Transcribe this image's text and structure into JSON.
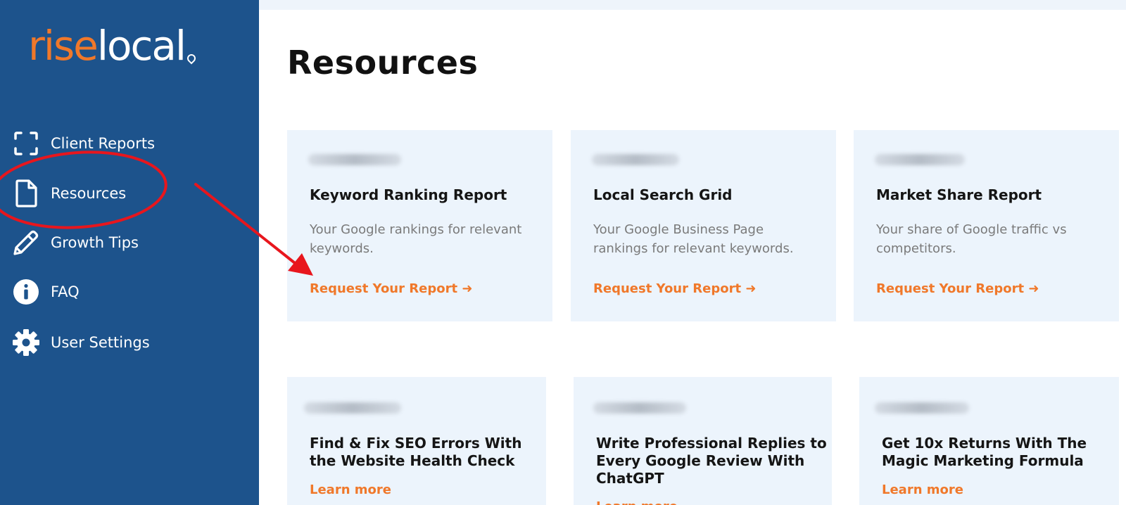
{
  "brand": {
    "logo_rise": "rise",
    "logo_local": "local",
    "accent_color": "#f0782a",
    "sidebar_color": "#1d538c",
    "card_bg": "#ecf4fc"
  },
  "sidebar": {
    "items": [
      {
        "label": "Client Reports",
        "icon": "scan-frame-icon"
      },
      {
        "label": "Resources",
        "icon": "document-icon"
      },
      {
        "label": "Growth Tips",
        "icon": "pencil-icon"
      },
      {
        "label": "FAQ",
        "icon": "info-icon"
      },
      {
        "label": "User Settings",
        "icon": "gear-icon"
      }
    ]
  },
  "main": {
    "title": "Resources",
    "report_cards": [
      {
        "title": "Keyword Ranking Report",
        "desc_1": "Your Google rankings for relevant",
        "desc_2": "keywords.",
        "link": "Request Your Report"
      },
      {
        "title": "Local Search Grid",
        "desc_1": "Your Google Business Page",
        "desc_2": "rankings for relevant keywords.",
        "link": "Request Your Report"
      },
      {
        "title": "Market Share Report",
        "desc_1": "Your share of Google traffic vs",
        "desc_2": "competitors.",
        "link": "Request Your Report"
      }
    ],
    "tip_cards": [
      {
        "title_1": "Find & Fix SEO Errors With",
        "title_2": "the Website Health Check",
        "title_3": "",
        "link": "Learn more"
      },
      {
        "title_1": "Write Professional Replies to",
        "title_2": "Every Google Review With",
        "title_3": "ChatGPT",
        "link": "Learn more"
      },
      {
        "title_1": "Get 10x Returns With The",
        "title_2": "Magic Marketing Formula",
        "title_3": "",
        "link": "Learn more"
      }
    ]
  },
  "annotation": {
    "color": "#e8161d"
  }
}
